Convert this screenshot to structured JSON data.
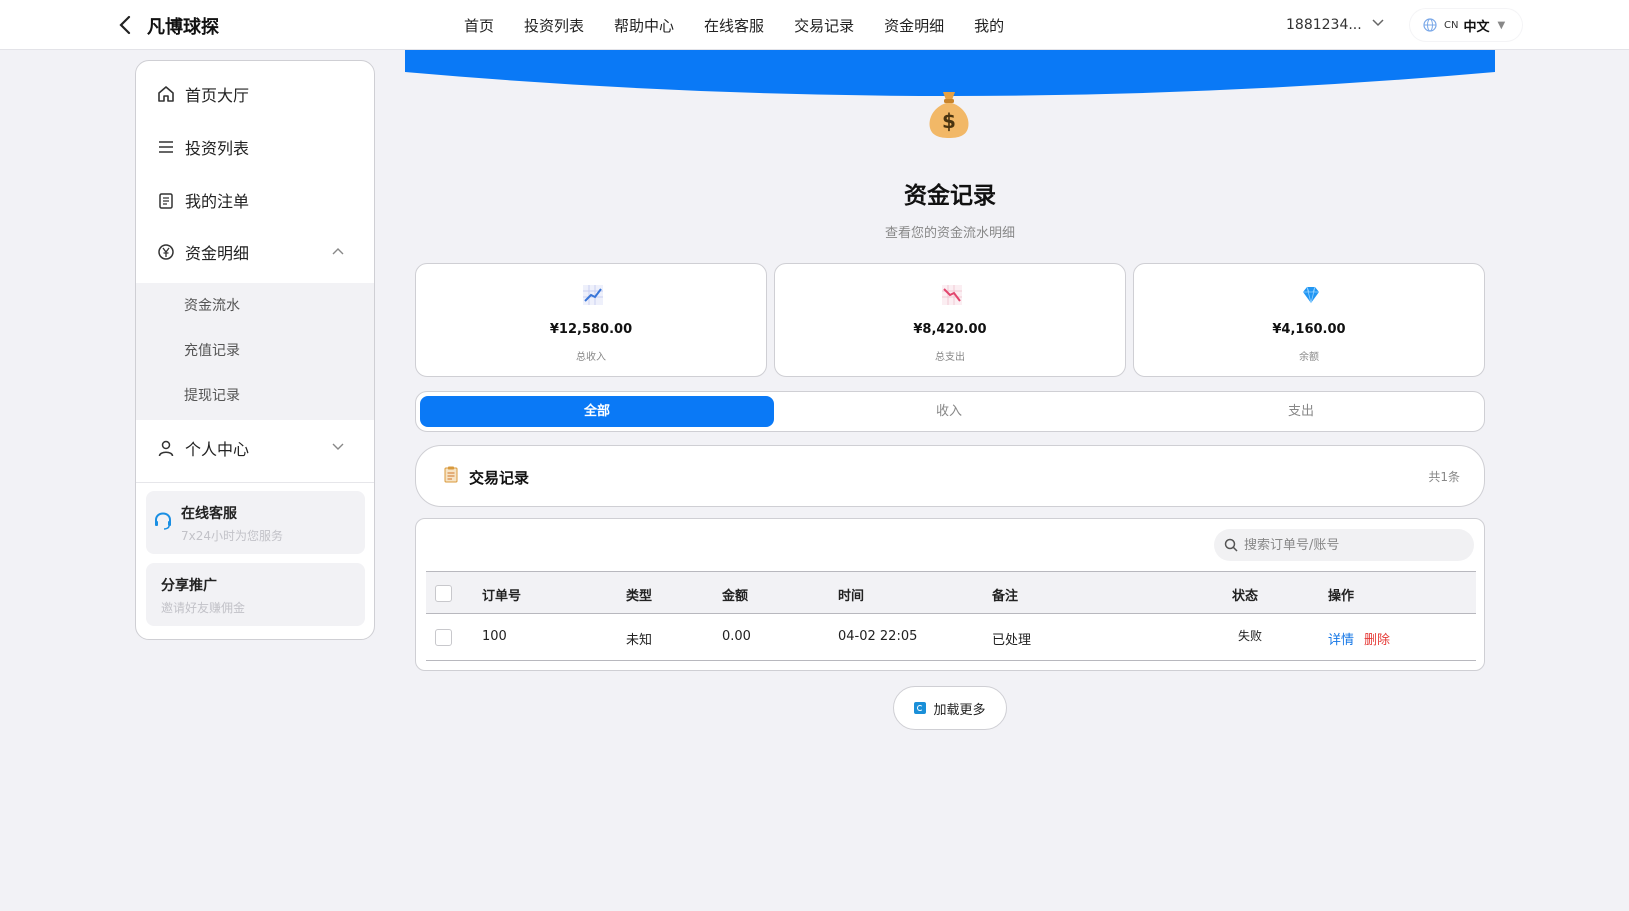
{
  "header": {
    "brand": "凡博球探",
    "nav": [
      "首页",
      "投资列表",
      "帮助中心",
      "在线客服",
      "交易记录",
      "资金明细",
      "我的"
    ],
    "user": "1881234...",
    "lang_code": "CN",
    "lang_label": "中文"
  },
  "sidebar": {
    "items": [
      {
        "label": "首页大厅",
        "icon": "home-icon"
      },
      {
        "label": "投资列表",
        "icon": "menu-icon"
      },
      {
        "label": "我的注单",
        "icon": "clipboard-icon"
      },
      {
        "label": "资金明细",
        "icon": "yen-circle-icon"
      },
      {
        "label": "个人中心",
        "icon": "user-icon"
      }
    ],
    "submenu": [
      "资金流水",
      "充值记录",
      "提现记录"
    ],
    "service": {
      "title": "在线客服",
      "sub": "7x24小时为您服务"
    },
    "share": {
      "title": "分享推广",
      "sub": "邀请好友赚佣金"
    }
  },
  "main": {
    "title": "资金记录",
    "subtitle": "查看您的资金流水明细",
    "stats": [
      {
        "value": "¥12,580.00",
        "label": "总收入",
        "icon": "chart-up-icon"
      },
      {
        "value": "¥8,420.00",
        "label": "总支出",
        "icon": "chart-down-icon"
      },
      {
        "value": "¥4,160.00",
        "label": "余额",
        "icon": "diamond-icon"
      }
    ],
    "tabs": [
      "全部",
      "收入",
      "支出"
    ],
    "records_title": "交易记录",
    "records_count": "共1条",
    "search_placeholder": "搜索订单号/账号",
    "columns": [
      "订单号",
      "类型",
      "金额",
      "时间",
      "备注",
      "状态",
      "操作"
    ],
    "rows": [
      {
        "order": "100",
        "type": "未知",
        "amount": "0.00",
        "time": "04-02 22:05",
        "remark": "已处理",
        "status": "失败",
        "detail": "详情",
        "delete": "删除"
      }
    ],
    "load_more": "加载更多"
  },
  "colors": {
    "accent": "#0a79f6",
    "danger": "#e53935",
    "link": "#1677e6"
  }
}
